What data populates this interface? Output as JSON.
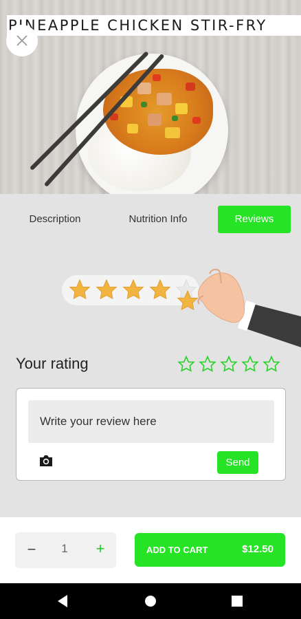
{
  "recipe": {
    "title": "PINEAPPLE CHICKEN STIR-FRY"
  },
  "icons": {
    "close": "close-icon",
    "camera": "camera-icon",
    "star_outline": "star-outline-icon"
  },
  "tabs": [
    {
      "label": "Description",
      "active": false
    },
    {
      "label": "Nutrition Info",
      "active": false
    },
    {
      "label": "Reviews",
      "active": true
    }
  ],
  "rating": {
    "label": "Your rating",
    "max": 5,
    "value": 0
  },
  "illustration": {
    "stars_filled": 4,
    "stars_total": 5
  },
  "review": {
    "placeholder": "Write your review here",
    "send_label": "Send"
  },
  "cart": {
    "minus": "−",
    "quantity": "1",
    "plus": "+",
    "add_label": "ADD TO CART",
    "price": "$12.50"
  },
  "colors": {
    "accent": "#26e326",
    "background": "#e3e3e3",
    "star_gold": "#f5b43c"
  }
}
